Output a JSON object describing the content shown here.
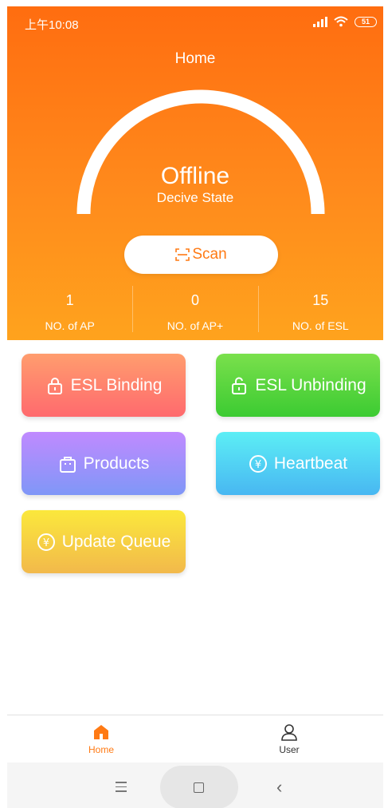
{
  "status_bar": {
    "time": "上午10:08",
    "battery": "51"
  },
  "header": {
    "title": "Home"
  },
  "device": {
    "state_value": "Offline",
    "state_label": "Decive State"
  },
  "scan": {
    "label": "Scan"
  },
  "stats": [
    {
      "value": "1",
      "label": "NO. of AP"
    },
    {
      "value": "0",
      "label": "NO. of AP+"
    },
    {
      "value": "15",
      "label": "NO. of ESL"
    }
  ],
  "tiles": {
    "esl_binding": "ESL Binding",
    "esl_unbinding": "ESL Unbinding",
    "products": "Products",
    "heartbeat": "Heartbeat",
    "update_queue": "Update Queue"
  },
  "bottom_nav": {
    "home": "Home",
    "user": "User"
  },
  "colors": {
    "accent": "#ff7a14",
    "header_top": "#ff6d10",
    "header_bottom": "#ffa31d"
  }
}
